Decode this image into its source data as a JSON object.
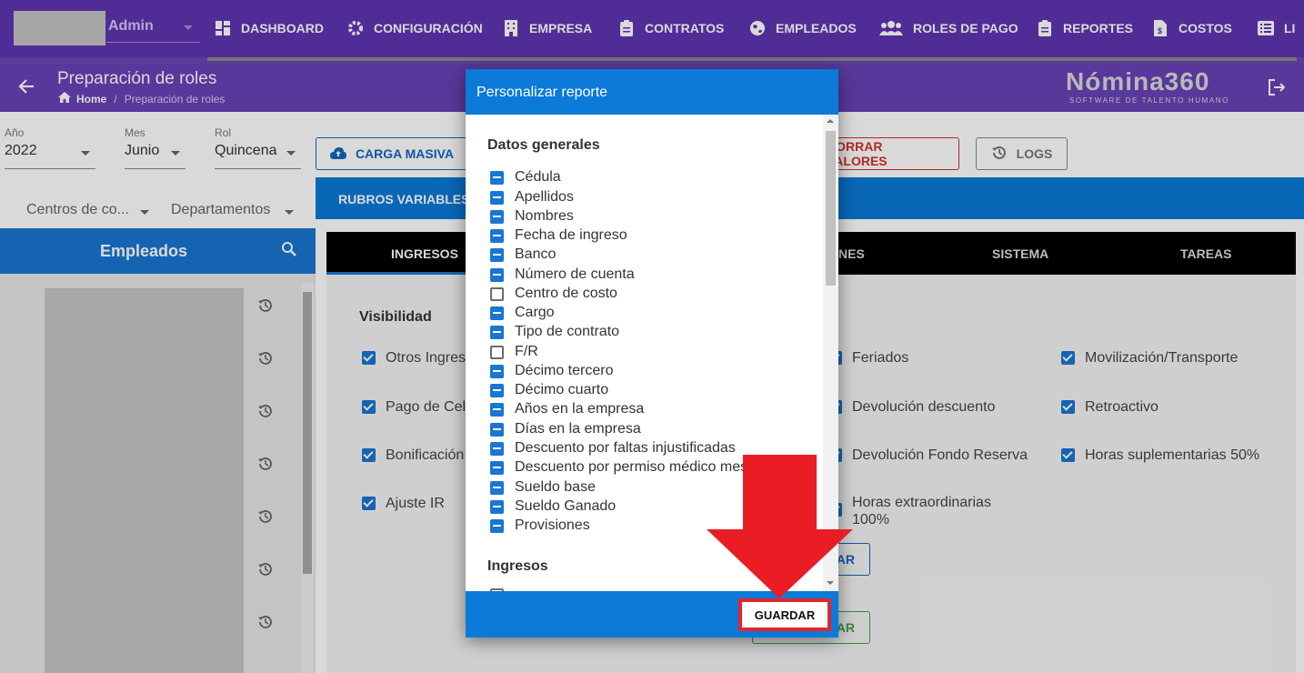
{
  "topnav": {
    "admin": "Admin",
    "items": [
      {
        "label": "DASHBOARD",
        "icon": "dashboard-icon"
      },
      {
        "label": "CONFIGURACIÓN",
        "icon": "gear-icon"
      },
      {
        "label": "EMPRESA",
        "icon": "building-icon"
      },
      {
        "label": "CONTRATOS",
        "icon": "clipboard-icon"
      },
      {
        "label": "EMPLEADOS",
        "icon": "globe-icon"
      },
      {
        "label": "ROLES DE PAGO",
        "icon": "users-icon"
      },
      {
        "label": "REPORTES",
        "icon": "clipboard-icon"
      },
      {
        "label": "COSTOS",
        "icon": "file-dollar-icon"
      },
      {
        "label": "LI",
        "icon": "list-icon"
      }
    ]
  },
  "header": {
    "title": "Preparación de roles",
    "breadcrumb": {
      "home": "Home",
      "separator": "/",
      "current": "Preparación de roles"
    },
    "logo": "Nómina360",
    "logo_sub": "SOFTWARE DE TALENTO HUMANO"
  },
  "filters": {
    "anio": {
      "label": "Año",
      "value": "2022"
    },
    "mes": {
      "label": "Mes",
      "value": "Junio"
    },
    "rol": {
      "label": "Rol",
      "value": "Quincena"
    },
    "centros": "Centros de co...",
    "departamentos": "Departamentos"
  },
  "actions": {
    "carga_masiva": "CARGA MASIVA",
    "borrar_valores": "BORRAR VALORES",
    "logs": "LOGS"
  },
  "rubros_label": "RUBROS VARIABLES",
  "empleados": {
    "title": "Empleados"
  },
  "tabs": [
    "INGRESOS",
    "NES",
    "SISTEMA",
    "TAREAS"
  ],
  "visibilidad": {
    "title": "Visibilidad",
    "left": [
      "Otros Ingres",
      "Pago de Celu",
      "Bonificación",
      "Ajuste IR"
    ],
    "mid": [
      "Feriados",
      "Devolución descuento",
      "Devolución Fondo Reserva",
      "Horas extraordinarias 100%"
    ],
    "right": [
      "Movilización/Transporte",
      "Retroactivo",
      "Horas suplementarias 50%"
    ],
    "btn_blue_partial": "AR",
    "btn_green_partial": "AR"
  },
  "dialog": {
    "title": "Personalizar reporte",
    "section_general": "Datos generales",
    "items": [
      {
        "label": "Cédula",
        "state": "indeterminate"
      },
      {
        "label": "Apellidos",
        "state": "indeterminate"
      },
      {
        "label": "Nombres",
        "state": "indeterminate"
      },
      {
        "label": "Fecha de ingreso",
        "state": "indeterminate"
      },
      {
        "label": "Banco",
        "state": "indeterminate"
      },
      {
        "label": "Número de cuenta",
        "state": "indeterminate"
      },
      {
        "label": "Centro de costo",
        "state": "unchecked"
      },
      {
        "label": "Cargo",
        "state": "indeterminate"
      },
      {
        "label": "Tipo de contrato",
        "state": "indeterminate"
      },
      {
        "label": "F/R",
        "state": "unchecked"
      },
      {
        "label": "Décimo tercero",
        "state": "indeterminate"
      },
      {
        "label": "Décimo cuarto",
        "state": "indeterminate"
      },
      {
        "label": "Años en la empresa",
        "state": "indeterminate"
      },
      {
        "label": "Días en la empresa",
        "state": "indeterminate"
      },
      {
        "label": "Descuento por faltas injustificadas",
        "state": "indeterminate"
      },
      {
        "label": "Descuento por permiso médico mes",
        "state": "indeterminate"
      },
      {
        "label": "Sueldo base",
        "state": "indeterminate"
      },
      {
        "label": "Sueldo Ganado",
        "state": "indeterminate"
      },
      {
        "label": "Provisiones",
        "state": "indeterminate"
      }
    ],
    "section_ingresos": "Ingresos",
    "save_label": "GUARDAR"
  },
  "colors": {
    "nav": "#5e35b1",
    "primary": "#1976d2",
    "danger": "#e0262b",
    "arrow": "#ea1c24"
  }
}
